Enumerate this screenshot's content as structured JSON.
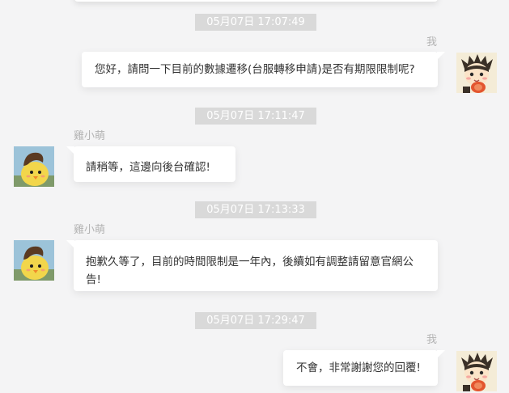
{
  "chat": {
    "self_label": "我",
    "agent_name": "雞小萌",
    "messages": [
      {
        "timestamp": "05月07日 17:07:49",
        "sender": "user",
        "text": "您好，請問一下目前的數據遷移(台服轉移申請)是否有期限限制呢?"
      },
      {
        "timestamp": "05月07日 17:11:47",
        "sender": "agent",
        "text": "請稍等，這邊向後台確認!"
      },
      {
        "timestamp": "05月07日 17:13:33",
        "sender": "agent",
        "text": "抱歉久等了，目前的時間限制是一年內，後續如有調整請留意官網公告!"
      },
      {
        "timestamp": "05月07日 17:29:47",
        "sender": "user",
        "text": "不會，非常謝謝您的回覆!"
      }
    ],
    "icons": {
      "user_avatar": "user-avatar-icon",
      "agent_avatar": "agent-avatar-icon"
    },
    "colors": {
      "background": "#f4f4f5",
      "bubble": "#ffffff",
      "timestamp_bg": "#d9d9d9",
      "timestamp_text": "#ffffff",
      "name_text": "#b3b3b3",
      "message_text": "#333333"
    }
  }
}
